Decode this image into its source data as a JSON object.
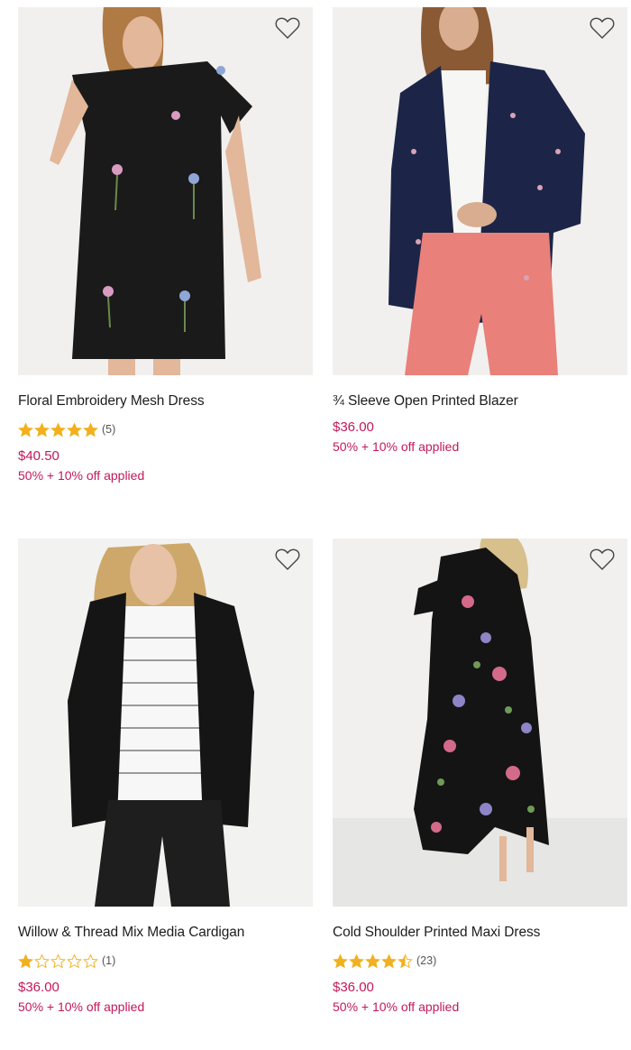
{
  "colors": {
    "price": "#c2185b",
    "star": "#f2b01e",
    "text": "#1d1d1d"
  },
  "icons": {
    "favorite": "heart-outline-icon",
    "rating": "star-icon"
  },
  "products": [
    {
      "title": "Floral Embroidery Mesh Dress",
      "rating": 5,
      "review_count": "(5)",
      "price": "$40.50",
      "promo": "50% + 10% off applied"
    },
    {
      "title": "¾ Sleeve Open Printed Blazer",
      "rating": null,
      "review_count": null,
      "price": "$36.00",
      "promo": "50% + 10% off applied"
    },
    {
      "title": "Willow & Thread Mix Media Cardigan",
      "rating": 1,
      "review_count": "(1)",
      "price": "$36.00",
      "promo": "50% + 10% off applied"
    },
    {
      "title": "Cold Shoulder Printed Maxi Dress",
      "rating": 4.5,
      "review_count": "(23)",
      "price": "$36.00",
      "promo": "50% + 10% off applied"
    }
  ]
}
